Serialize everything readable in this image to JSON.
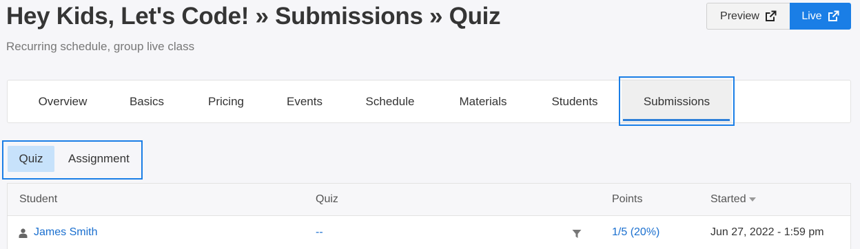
{
  "header": {
    "title": "Hey Kids, Let's Code! » Submissions » Quiz",
    "subtitle": "Recurring schedule, group live class",
    "preview_label": "Preview",
    "live_label": "Live"
  },
  "main_tabs": [
    {
      "label": "Overview"
    },
    {
      "label": "Basics"
    },
    {
      "label": "Pricing"
    },
    {
      "label": "Events"
    },
    {
      "label": "Schedule"
    },
    {
      "label": "Materials"
    },
    {
      "label": "Students"
    },
    {
      "label": "Submissions",
      "active": true
    }
  ],
  "sub_tabs": {
    "quiz": "Quiz",
    "assignment": "Assignment",
    "active": "Quiz"
  },
  "table": {
    "columns": [
      "Student",
      "Quiz",
      "Points",
      "Started"
    ],
    "sort_column": "Started",
    "rows": [
      {
        "student": "James Smith",
        "quiz": "--",
        "points": "1/5 (20%)",
        "started": "Jun 27, 2022 - 1:59 pm"
      }
    ]
  },
  "colors": {
    "accent": "#1a7ee6",
    "link": "#1a6fcf",
    "active_subtab_bg": "#c7e2fb"
  },
  "icons": {
    "external_link": "external-link-icon",
    "user": "user-icon",
    "filter": "filter-icon",
    "sort": "caret-down-icon"
  }
}
